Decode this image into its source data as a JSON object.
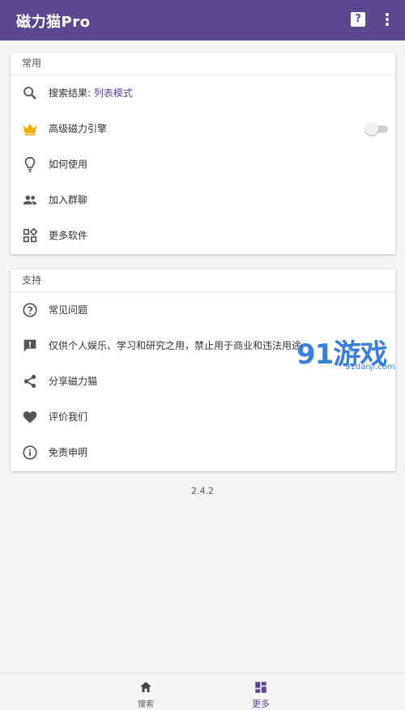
{
  "appbar": {
    "title": "磁力猫Pro",
    "help_icon": "help-icon",
    "more_icon": "more-vert-icon"
  },
  "colors": {
    "primary": "#5c4891",
    "background": "#f5f5f5",
    "crown": "#f0b000"
  },
  "common": {
    "header": "常用",
    "items": [
      {
        "icon": "search-icon",
        "label": "搜索结果:",
        "accent": "列表模式"
      },
      {
        "icon": "crown-icon",
        "label": "高级磁力引擎",
        "toggle_on": false
      },
      {
        "icon": "lightbulb-icon",
        "label": "如何使用"
      },
      {
        "icon": "group-icon",
        "label": "加入群聊"
      },
      {
        "icon": "apps-icon",
        "label": "更多软件"
      }
    ]
  },
  "support": {
    "header": "支持",
    "items": [
      {
        "icon": "help-circle-icon",
        "label": "常见问题"
      },
      {
        "icon": "feedback-icon",
        "label": "仅供个人娱乐、学习和研究之用，禁止用于商业和违法用途"
      },
      {
        "icon": "share-icon",
        "label": "分享磁力猫"
      },
      {
        "icon": "heart-icon",
        "label": "评价我们"
      },
      {
        "icon": "info-icon",
        "label": "免责申明"
      }
    ]
  },
  "version": "2.4.2",
  "watermark": {
    "big": "91游戏",
    "small": "91danji.com"
  },
  "bottom_nav": [
    {
      "icon": "home-icon",
      "label": "搜索"
    },
    {
      "icon": "dashboard-icon",
      "label": "更多",
      "active": true
    }
  ]
}
